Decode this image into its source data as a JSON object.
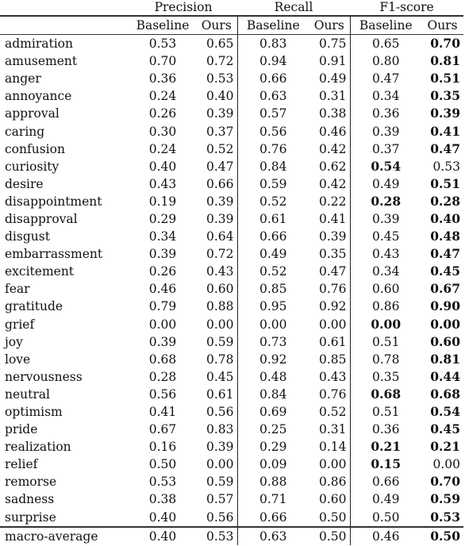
{
  "table": {
    "group_headers": [
      "Precision",
      "Recall",
      "F1-score"
    ],
    "sub_headers": [
      "Baseline",
      "Ours",
      "Baseline",
      "Ours",
      "Baseline",
      "Ours"
    ],
    "rows": [
      {
        "label": "admiration",
        "values": [
          "0.53",
          "0.65",
          "0.83",
          "0.75",
          "0.65",
          "0.70"
        ],
        "bold": [
          false,
          false,
          false,
          false,
          false,
          true
        ]
      },
      {
        "label": "amusement",
        "values": [
          "0.70",
          "0.72",
          "0.94",
          "0.91",
          "0.80",
          "0.81"
        ],
        "bold": [
          false,
          false,
          false,
          false,
          false,
          true
        ]
      },
      {
        "label": "anger",
        "values": [
          "0.36",
          "0.53",
          "0.66",
          "0.49",
          "0.47",
          "0.51"
        ],
        "bold": [
          false,
          false,
          false,
          false,
          false,
          true
        ]
      },
      {
        "label": "annoyance",
        "values": [
          "0.24",
          "0.40",
          "0.63",
          "0.31",
          "0.34",
          "0.35"
        ],
        "bold": [
          false,
          false,
          false,
          false,
          false,
          true
        ]
      },
      {
        "label": "approval",
        "values": [
          "0.26",
          "0.39",
          "0.57",
          "0.38",
          "0.36",
          "0.39"
        ],
        "bold": [
          false,
          false,
          false,
          false,
          false,
          true
        ]
      },
      {
        "label": "caring",
        "values": [
          "0.30",
          "0.37",
          "0.56",
          "0.46",
          "0.39",
          "0.41"
        ],
        "bold": [
          false,
          false,
          false,
          false,
          false,
          true
        ]
      },
      {
        "label": "confusion",
        "values": [
          "0.24",
          "0.52",
          "0.76",
          "0.42",
          "0.37",
          "0.47"
        ],
        "bold": [
          false,
          false,
          false,
          false,
          false,
          true
        ]
      },
      {
        "label": "curiosity",
        "values": [
          "0.40",
          "0.47",
          "0.84",
          "0.62",
          "0.54",
          "0.53"
        ],
        "bold": [
          false,
          false,
          false,
          false,
          true,
          false
        ]
      },
      {
        "label": "desire",
        "values": [
          "0.43",
          "0.66",
          "0.59",
          "0.42",
          "0.49",
          "0.51"
        ],
        "bold": [
          false,
          false,
          false,
          false,
          false,
          true
        ]
      },
      {
        "label": "disappointment",
        "values": [
          "0.19",
          "0.39",
          "0.52",
          "0.22",
          "0.28",
          "0.28"
        ],
        "bold": [
          false,
          false,
          false,
          false,
          true,
          true
        ]
      },
      {
        "label": "disapproval",
        "values": [
          "0.29",
          "0.39",
          "0.61",
          "0.41",
          "0.39",
          "0.40"
        ],
        "bold": [
          false,
          false,
          false,
          false,
          false,
          true
        ]
      },
      {
        "label": "disgust",
        "values": [
          "0.34",
          "0.64",
          "0.66",
          "0.39",
          "0.45",
          "0.48"
        ],
        "bold": [
          false,
          false,
          false,
          false,
          false,
          true
        ]
      },
      {
        "label": "embarrassment",
        "values": [
          "0.39",
          "0.72",
          "0.49",
          "0.35",
          "0.43",
          "0.47"
        ],
        "bold": [
          false,
          false,
          false,
          false,
          false,
          true
        ]
      },
      {
        "label": "excitement",
        "values": [
          "0.26",
          "0.43",
          "0.52",
          "0.47",
          "0.34",
          "0.45"
        ],
        "bold": [
          false,
          false,
          false,
          false,
          false,
          true
        ]
      },
      {
        "label": "fear",
        "values": [
          "0.46",
          "0.60",
          "0.85",
          "0.76",
          "0.60",
          "0.67"
        ],
        "bold": [
          false,
          false,
          false,
          false,
          false,
          true
        ]
      },
      {
        "label": "gratitude",
        "values": [
          "0.79",
          "0.88",
          "0.95",
          "0.92",
          "0.86",
          "0.90"
        ],
        "bold": [
          false,
          false,
          false,
          false,
          false,
          true
        ]
      },
      {
        "label": "grief",
        "values": [
          "0.00",
          "0.00",
          "0.00",
          "0.00",
          "0.00",
          "0.00"
        ],
        "bold": [
          false,
          false,
          false,
          false,
          true,
          true
        ]
      },
      {
        "label": "joy",
        "values": [
          "0.39",
          "0.59",
          "0.73",
          "0.61",
          "0.51",
          "0.60"
        ],
        "bold": [
          false,
          false,
          false,
          false,
          false,
          true
        ]
      },
      {
        "label": "love",
        "values": [
          "0.68",
          "0.78",
          "0.92",
          "0.85",
          "0.78",
          "0.81"
        ],
        "bold": [
          false,
          false,
          false,
          false,
          false,
          true
        ]
      },
      {
        "label": "nervousness",
        "values": [
          "0.28",
          "0.45",
          "0.48",
          "0.43",
          "0.35",
          "0.44"
        ],
        "bold": [
          false,
          false,
          false,
          false,
          false,
          true
        ]
      },
      {
        "label": "neutral",
        "values": [
          "0.56",
          "0.61",
          "0.84",
          "0.76",
          "0.68",
          "0.68"
        ],
        "bold": [
          false,
          false,
          false,
          false,
          true,
          true
        ]
      },
      {
        "label": "optimism",
        "values": [
          "0.41",
          "0.56",
          "0.69",
          "0.52",
          "0.51",
          "0.54"
        ],
        "bold": [
          false,
          false,
          false,
          false,
          false,
          true
        ]
      },
      {
        "label": "pride",
        "values": [
          "0.67",
          "0.83",
          "0.25",
          "0.31",
          "0.36",
          "0.45"
        ],
        "bold": [
          false,
          false,
          false,
          false,
          false,
          true
        ]
      },
      {
        "label": "realization",
        "values": [
          "0.16",
          "0.39",
          "0.29",
          "0.14",
          "0.21",
          "0.21"
        ],
        "bold": [
          false,
          false,
          false,
          false,
          true,
          true
        ]
      },
      {
        "label": "relief",
        "values": [
          "0.50",
          "0.00",
          "0.09",
          "0.00",
          "0.15",
          "0.00"
        ],
        "bold": [
          false,
          false,
          false,
          false,
          true,
          false
        ]
      },
      {
        "label": "remorse",
        "values": [
          "0.53",
          "0.59",
          "0.88",
          "0.86",
          "0.66",
          "0.70"
        ],
        "bold": [
          false,
          false,
          false,
          false,
          false,
          true
        ]
      },
      {
        "label": "sadness",
        "values": [
          "0.38",
          "0.57",
          "0.71",
          "0.60",
          "0.49",
          "0.59"
        ],
        "bold": [
          false,
          false,
          false,
          false,
          false,
          true
        ]
      },
      {
        "label": "surprise",
        "values": [
          "0.40",
          "0.56",
          "0.66",
          "0.50",
          "0.50",
          "0.53"
        ],
        "bold": [
          false,
          false,
          false,
          false,
          false,
          true
        ]
      }
    ],
    "average_row": {
      "label": "macro-average",
      "values": [
        "0.40",
        "0.53",
        "0.63",
        "0.50",
        "0.46",
        "0.50"
      ],
      "bold": [
        false,
        false,
        false,
        false,
        false,
        true
      ]
    }
  }
}
